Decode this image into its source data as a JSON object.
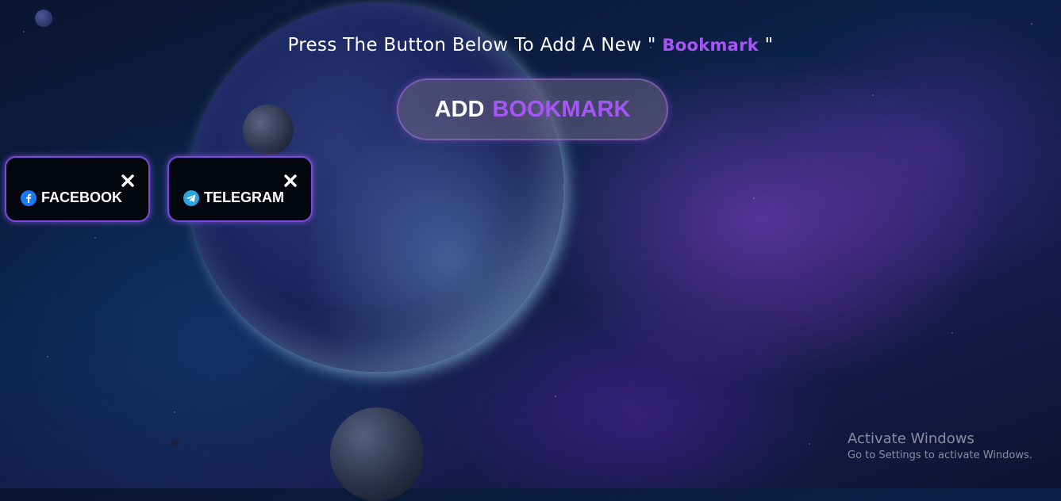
{
  "heading": {
    "text_before": "Press The Button Below To Add A New \" ",
    "accent": "Bookmark",
    "text_after": " \""
  },
  "add_button": {
    "label_main": "ADD",
    "label_accent": "BOOKMARK"
  },
  "bookmarks": [
    {
      "label": "FACEBOOK",
      "icon": "facebook-icon"
    },
    {
      "label": "TELEGRAM",
      "icon": "telegram-icon"
    }
  ],
  "watermark": {
    "title": "Activate Windows",
    "subtitle": "Go to Settings to activate Windows."
  },
  "colors": {
    "accent": "#a855f7",
    "card_border": "#7a4ad6",
    "card_bg": "#05070f",
    "facebook": "#1877f2",
    "telegram": "#2aa3df"
  }
}
